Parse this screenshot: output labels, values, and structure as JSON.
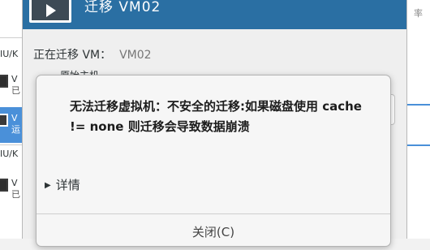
{
  "background": {
    "path_label": "IU/K",
    "path_label_2": "IU/K",
    "items": [
      {
        "name": "V",
        "status": "已"
      },
      {
        "name": "V",
        "status": "运"
      },
      {
        "name": "V",
        "status": "已"
      }
    ],
    "right_header": "率"
  },
  "migrate_dialog": {
    "title": "迁移 VM02",
    "migrating_label": "正在迁移 VM：",
    "vm_name": "VM02",
    "source_host_label": "原始主机"
  },
  "error_dialog": {
    "message": "无法迁移虚拟机：不安全的迁移:如果磁盘使用  cache != none 则迁移会导致数据崩溃",
    "details_label": "详情",
    "close_label": "关闭(C)"
  },
  "colors": {
    "titlebar": "#2a6fa3",
    "selection": "#4a90d9"
  }
}
